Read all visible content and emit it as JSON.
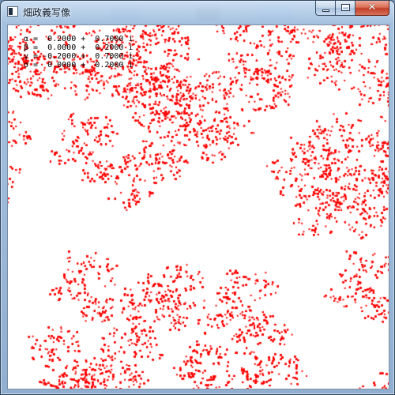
{
  "window": {
    "title": "畑政義写像"
  },
  "icons": {
    "app": "app-window-icon",
    "minimize": "minimize-icon",
    "maximize": "maximize-icon",
    "close": "close-icon"
  },
  "params": {
    "alpha": "α =  0.2000 +  0.7000 i",
    "beta": "β =  0.0000 +  0.2000 i",
    "gamma": "γ = -0.2000 +  0.7000 i",
    "sigma": "σ =  0.0000 +  0.2000 i"
  },
  "fractal": {
    "color": "#ff0000"
  },
  "colors": {
    "background": "#ffffff",
    "fractal": "#ff0000",
    "text": "#000000"
  }
}
